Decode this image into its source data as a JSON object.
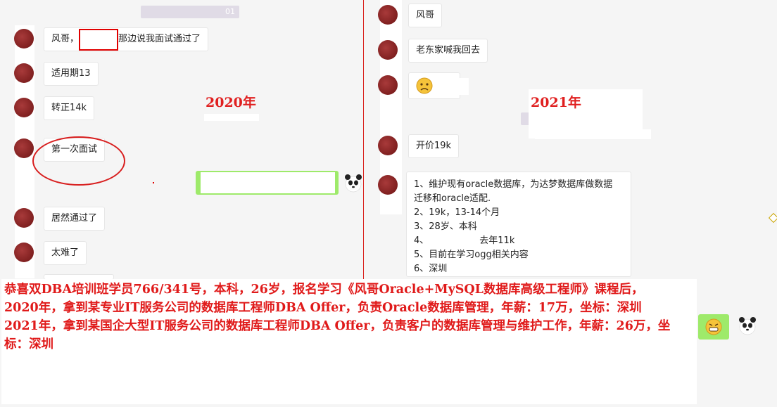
{
  "left_chat": {
    "year_label": "2020年",
    "messages": [
      {
        "label": "风哥，",
        "tail": "那边说我面试通过了"
      },
      {
        "label": "适用期13"
      },
      {
        "label": "转正14k"
      },
      {
        "label": "第一次面试"
      },
      {
        "label": "居然通过了"
      },
      {
        "label": "太难了"
      }
    ],
    "timestamp_tail": "01"
  },
  "right_chat": {
    "year_label": "2021年",
    "messages": [
      {
        "label": "风哥"
      },
      {
        "label": "老东家喊我回去"
      },
      {
        "label": "开价19k"
      }
    ],
    "details": [
      "1、维护现有oracle数据库，为达梦数据库做数据",
      "迁移和oracle适配.",
      "2、19k，13-14个月",
      "3、28岁、本科",
      "4、",
      "去年11k",
      "5、目前在学习ogg相关内容",
      "6、深圳"
    ]
  },
  "caption": {
    "lines": [
      "恭喜双DBA培训班学员766/341号，本科，26岁，报名学习《风哥Oracle+MySQL数据库高级工程师》课程后，",
      "2020年，拿到某专业IT服务公司的数据库工程师DBA Offer，负责Oracle数据库管理，年薪：17万，坐标：深圳",
      "2021年，拿到某国企大型IT服务公司的数据库工程师DBA Offer，负责客户的数据库管理与维护工作，年薪：26万，坐标：深圳"
    ]
  },
  "icons": {
    "emoji_sad": "sad-face-emoji-icon",
    "emoji_grin": "grin-face-emoji-icon",
    "panda": "panda-avatar-icon"
  },
  "colors": {
    "annotation_red": "#e02020",
    "sent_bubble_green": "#9eea6a",
    "chat_background": "#f5f5f5"
  }
}
